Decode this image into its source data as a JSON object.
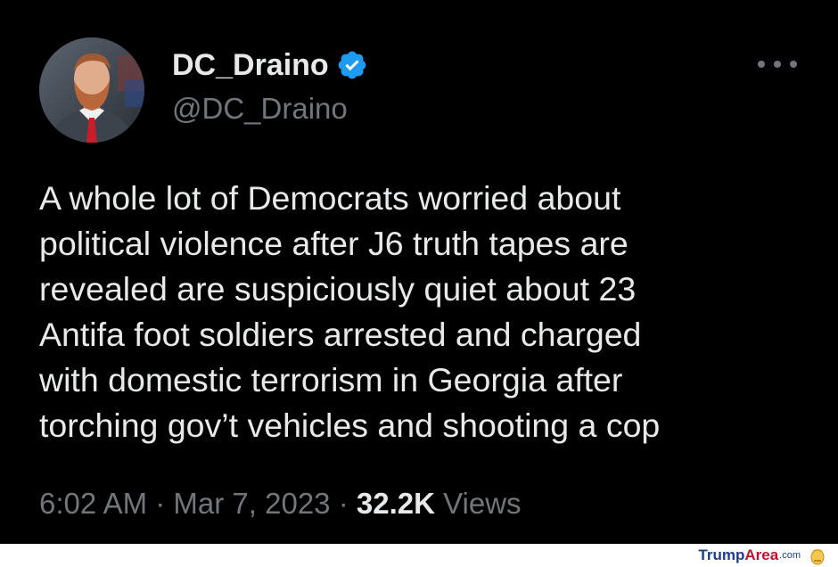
{
  "author": {
    "display_name": "DC_Draino",
    "handle": "@DC_Draino",
    "verified_icon": "verified-badge-icon"
  },
  "tweet": {
    "text": "A whole lot of Democrats worried about\npolitical violence after J6 truth tapes are\nrevealed are suspiciously quiet about 23\nAntifa foot soldiers arrested and charged\nwith domestic terrorism in Georgia after\ntorching gov’t vehicles and shooting a cop",
    "time": "6:02 AM",
    "date": "Mar 7, 2023",
    "separator": "·",
    "views_count": "32.2K",
    "views_label": "Views"
  },
  "watermark": {
    "part1": "Trump",
    "part2": "Area",
    "suffix": ".com"
  },
  "colors": {
    "background": "#000000",
    "text_primary": "#e7e9ea",
    "text_secondary": "#71767b",
    "verified_blue": "#1d9bf0"
  }
}
